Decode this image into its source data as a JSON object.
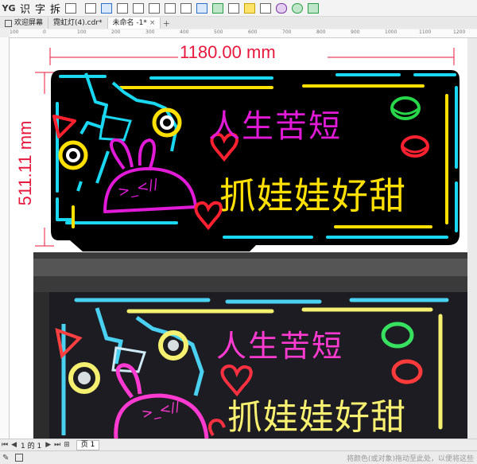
{
  "toolbar": {
    "logo": "YG",
    "tools": [
      "识",
      "字",
      "拆"
    ]
  },
  "tabs": [
    {
      "label": "欢迎屏幕",
      "home": true,
      "active": false
    },
    {
      "label": "霓虹灯(4).cdr*",
      "home": false,
      "active": false
    },
    {
      "label": "未命名 -1*",
      "home": false,
      "active": true
    }
  ],
  "ruler": {
    "ticks": [
      "100",
      "0",
      "100",
      "200",
      "300",
      "400",
      "500",
      "600",
      "700",
      "800",
      "900",
      "1000",
      "1100",
      "1200"
    ]
  },
  "dimensions": {
    "width_label": "1180.00 mm",
    "height_label": "511.11 mm"
  },
  "sign": {
    "line1": "人生苦短",
    "line2": "抓娃娃好甜",
    "face": ">_<//",
    "colors": {
      "background": "#000000",
      "frame": "#1ad8f2",
      "accent_yellow": "#ffe000",
      "magenta": "#e01ad6",
      "red": "#ff2030",
      "green": "#28d64a"
    }
  },
  "photo": {
    "line1": "人生苦短",
    "line2": "抓娃娃好甜",
    "face": ">_<//"
  },
  "pagebar": {
    "counter": "1 的 1",
    "page_tab": "页 1"
  },
  "status": {
    "hint": "将颜色(或对象)拖动至此处，以便将这些"
  }
}
